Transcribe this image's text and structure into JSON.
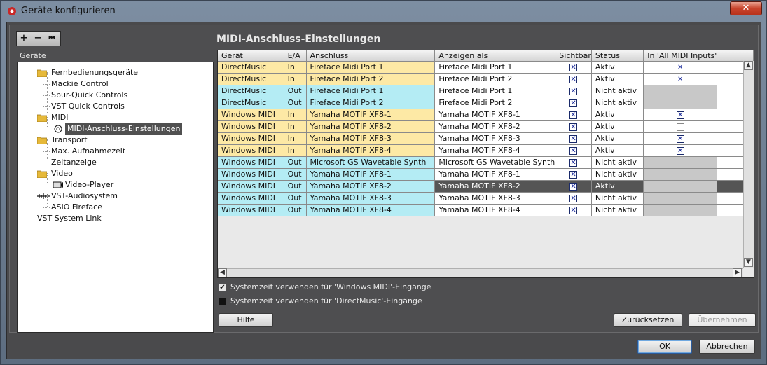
{
  "window": {
    "title": "Geräte konfigurieren",
    "close_label": "✕"
  },
  "toolbar": {
    "add": "+",
    "remove": "−",
    "reset": "⏮"
  },
  "tree": {
    "header": "Geräte",
    "items": [
      {
        "label": "Fernbedienungsgeräte",
        "type": "folder"
      },
      {
        "label": "Mackie Control",
        "type": "leaf"
      },
      {
        "label": "Spur-Quick Controls",
        "type": "leaf"
      },
      {
        "label": "VST Quick Controls",
        "type": "leaf"
      },
      {
        "label": "MIDI",
        "type": "folder"
      },
      {
        "label": "MIDI-Anschluss-Einstellungen",
        "type": "leaf",
        "selected": true
      },
      {
        "label": "Transport",
        "type": "folder"
      },
      {
        "label": "Max. Aufnahmezeit",
        "type": "leaf"
      },
      {
        "label": "Zeitanzeige",
        "type": "leaf"
      },
      {
        "label": "Video",
        "type": "folder"
      },
      {
        "label": "Video-Player",
        "type": "leaf"
      },
      {
        "label": "VST-Audiosystem",
        "type": "leaf"
      },
      {
        "label": "ASIO Fireface",
        "type": "leaf"
      },
      {
        "label": "VST System Link",
        "type": "leaf"
      }
    ]
  },
  "main": {
    "title": "MIDI-Anschluss-Einstellungen",
    "columns": [
      "Gerät",
      "E/A",
      "Anschluss",
      "Anzeigen als",
      "Sichtbar",
      "Status",
      "In 'All MIDI Inputs'",
      ""
    ],
    "rows": [
      {
        "geraet": "DirectMusic",
        "ea": "In",
        "anschluss": "Fireface Midi Port 1",
        "anzeigen": "Fireface Midi Port 1",
        "sichtbar": true,
        "status": "Aktiv",
        "allmidi": "checked"
      },
      {
        "geraet": "DirectMusic",
        "ea": "In",
        "anschluss": "Fireface Midi Port 2",
        "anzeigen": "Fireface Midi Port 2",
        "sichtbar": true,
        "status": "Aktiv",
        "allmidi": "checked"
      },
      {
        "geraet": "DirectMusic",
        "ea": "Out",
        "anschluss": "Fireface Midi Port 1",
        "anzeigen": "Fireface Midi Port 1",
        "sichtbar": true,
        "status": "Nicht aktiv",
        "allmidi": "na"
      },
      {
        "geraet": "DirectMusic",
        "ea": "Out",
        "anschluss": "Fireface Midi Port 2",
        "anzeigen": "Fireface Midi Port 2",
        "sichtbar": true,
        "status": "Nicht aktiv",
        "allmidi": "na"
      },
      {
        "geraet": "Windows MIDI",
        "ea": "In",
        "anschluss": "Yamaha MOTIF XF8-1",
        "anzeigen": "Yamaha MOTIF XF8-1",
        "sichtbar": true,
        "status": "Aktiv",
        "allmidi": "checked"
      },
      {
        "geraet": "Windows MIDI",
        "ea": "In",
        "anschluss": "Yamaha MOTIF XF8-2",
        "anzeigen": "Yamaha MOTIF XF8-2",
        "sichtbar": true,
        "status": "Aktiv",
        "allmidi": "unchecked"
      },
      {
        "geraet": "Windows MIDI",
        "ea": "In",
        "anschluss": "Yamaha MOTIF XF8-3",
        "anzeigen": "Yamaha MOTIF XF8-3",
        "sichtbar": true,
        "status": "Aktiv",
        "allmidi": "checked"
      },
      {
        "geraet": "Windows MIDI",
        "ea": "In",
        "anschluss": "Yamaha MOTIF XF8-4",
        "anzeigen": "Yamaha MOTIF XF8-4",
        "sichtbar": true,
        "status": "Aktiv",
        "allmidi": "checked"
      },
      {
        "geraet": "Windows MIDI",
        "ea": "Out",
        "anschluss": "Microsoft GS Wavetable Synth",
        "anzeigen": "Microsoft GS Wavetable Synth",
        "sichtbar": true,
        "status": "Nicht aktiv",
        "allmidi": "na"
      },
      {
        "geraet": "Windows MIDI",
        "ea": "Out",
        "anschluss": "Yamaha MOTIF XF8-1",
        "anzeigen": "Yamaha MOTIF XF8-1",
        "sichtbar": true,
        "status": "Nicht aktiv",
        "allmidi": "na"
      },
      {
        "geraet": "Windows MIDI",
        "ea": "Out",
        "anschluss": "Yamaha MOTIF XF8-2",
        "anzeigen": "Yamaha MOTIF XF8-2",
        "sichtbar": true,
        "status": "Aktiv",
        "allmidi": "na",
        "selected": true
      },
      {
        "geraet": "Windows MIDI",
        "ea": "Out",
        "anschluss": "Yamaha MOTIF XF8-3",
        "anzeigen": "Yamaha MOTIF XF8-3",
        "sichtbar": true,
        "status": "Nicht aktiv",
        "allmidi": "na"
      },
      {
        "geraet": "Windows MIDI",
        "ea": "Out",
        "anschluss": "Yamaha MOTIF XF8-4",
        "anzeigen": "Yamaha MOTIF XF8-4",
        "sichtbar": true,
        "status": "Nicht aktiv",
        "allmidi": "na"
      }
    ],
    "options": [
      {
        "label": "Systemzeit verwenden für 'Windows MIDI'-Eingänge",
        "checked": true
      },
      {
        "label": "Systemzeit verwenden für 'DirectMusic'-Eingänge",
        "checked": false
      }
    ],
    "buttons": {
      "help": "Hilfe",
      "reset": "Zurücksetzen",
      "apply": "Übernehmen"
    }
  },
  "footer": {
    "ok": "OK",
    "cancel": "Abbrechen"
  },
  "colors": {
    "in_row": "#fde9a5",
    "out_row": "#b4ecf4",
    "selected_row": "#555555",
    "checkbox": "#1a2a9a"
  }
}
